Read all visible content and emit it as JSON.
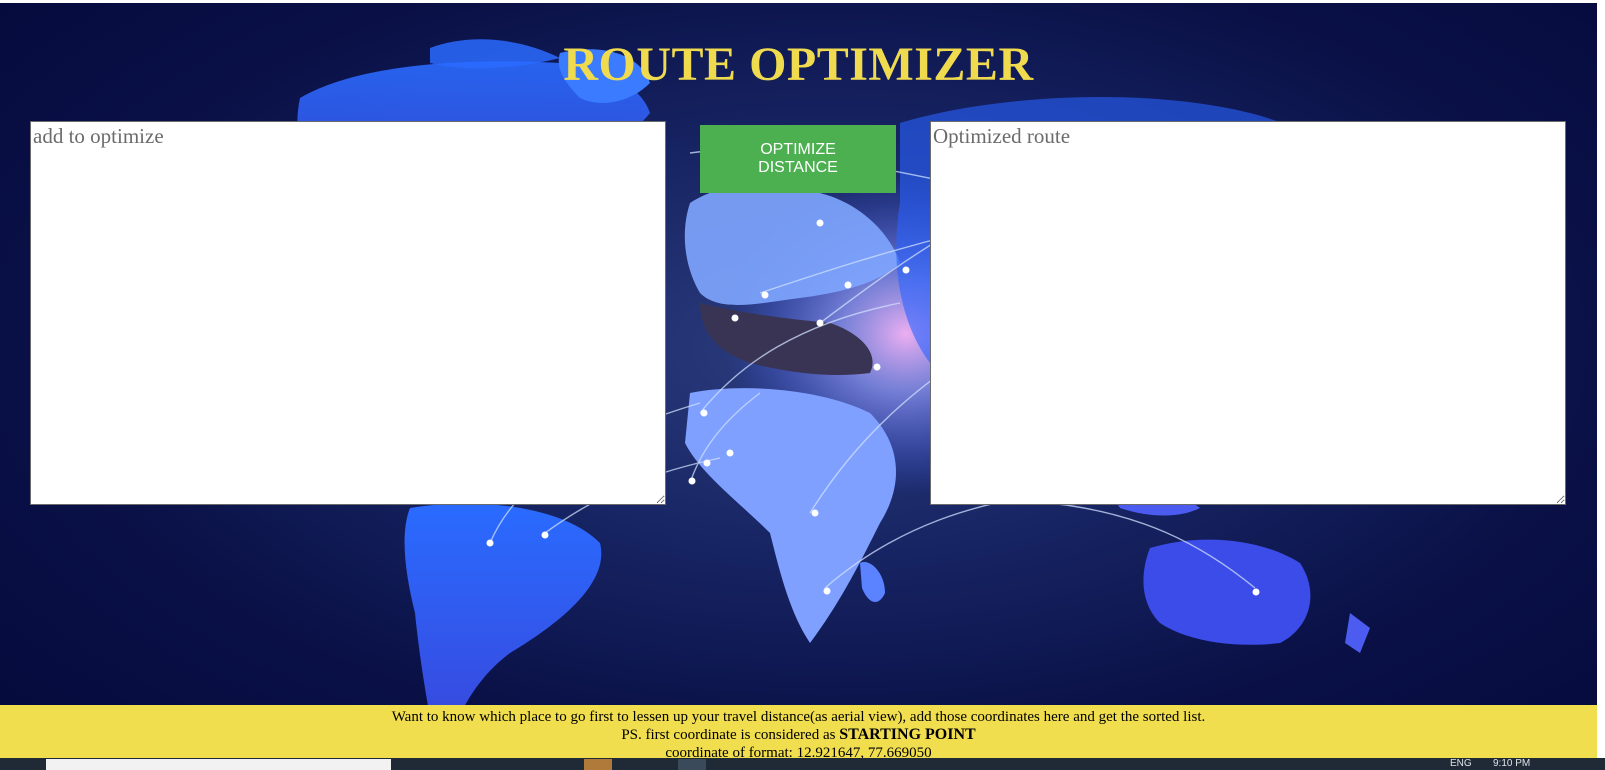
{
  "page": {
    "title": "ROUTE OPTIMIZER"
  },
  "input": {
    "placeholder": "add to optimize"
  },
  "button": {
    "label": "OPTIMIZE DISTANCE"
  },
  "output": {
    "placeholder": "Optimized route"
  },
  "footer": {
    "line1": "Want to know which place to go first to lessen up your travel distance(as aerial view), add those coordinates here and get the sorted list.",
    "line2_prefix": "PS. first coordinate is considered as",
    "line2_bold": "STARTING POINT",
    "line3": "coordinate of format: 12.921647, 77.669050"
  },
  "taskbar": {
    "lang": "ENG",
    "time": "9:10 PM"
  },
  "colors": {
    "title": "#f0db4f",
    "button_bg": "#4caf50",
    "footer_bg": "#f0de4e",
    "background": "#0a1147",
    "land": "#2f62f0"
  },
  "icons": [
    "world-map-background",
    "taskbar-app-icon"
  ]
}
